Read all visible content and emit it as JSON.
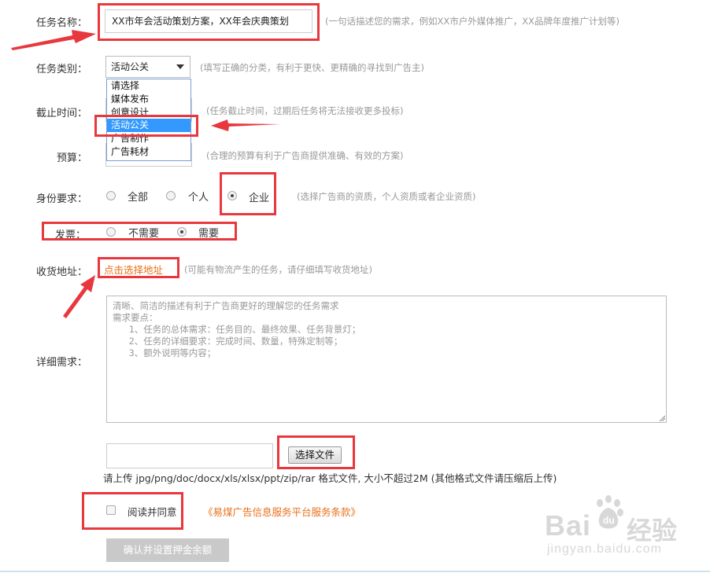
{
  "form": {
    "task_name": {
      "label": "任务名称：",
      "value": "XX市年会活动策划方案，XX年会庆典策划",
      "hint": "(一句话描述您的需求，例如XX市户外媒体推广，XX品牌年度推广计划等)"
    },
    "category": {
      "label": "任务类别：",
      "selected": "活动公关",
      "hint": "(填写正确的分类，有利于更快、更精确的寻找到广告主)",
      "options": [
        "请选择",
        "媒体发布",
        "创意设计",
        "活动公关",
        "广告制作",
        "广告耗材"
      ],
      "selected_index": 3
    },
    "deadline": {
      "label": "截止时间：",
      "hint": "(任务截止时间，过期后任务将无法接收更多投标)"
    },
    "budget": {
      "label": "预算：",
      "hint": "(合理的预算有利于广告商提供准确、有效的方案)"
    },
    "identity": {
      "label": "身份要求：",
      "options": [
        "全部",
        "个人",
        "企业"
      ],
      "selected_index": 2,
      "hint": "(选择广告商的资质，个人资质或者企业资质)"
    },
    "invoice": {
      "label": "发票：",
      "options": [
        "不需要",
        "需要"
      ],
      "selected_index": 1
    },
    "address": {
      "label": "收货地址：",
      "link": "点击选择地址",
      "hint": "(可能有物流产生的任务，请仔细填写收货地址)"
    },
    "detail": {
      "label": "详细需求：",
      "placeholder": "清晰、简洁的描述有利于广告商更好的理解您的任务需求\n需求要点：\n   1、任务的总体需求：任务目的、最终效果、任务背景灯；\n   2、任务的详细要求：完成时间、数量，特殊定制等；\n   3、额外说明等内容；"
    },
    "upload": {
      "button": "选择文件",
      "note": "请上传 jpg/png/doc/docx/xls/xlsx/ppt/zip/rar 格式文件, 大小不超过2M (其他格式文件请压缩后上传)"
    },
    "agreement": {
      "label": "阅读并同意",
      "link": "《易煤广告信息服务平台服务条款》"
    },
    "submit": "确认并设置押金余额"
  },
  "watermark": {
    "brand_left": "Bai",
    "brand_right": "经验",
    "url": "jingyan.baidu.com"
  },
  "colors": {
    "annotation_red": "#e8383d",
    "link_orange": "#e8701a",
    "selection_blue": "#3399ff",
    "hint_gray": "#999999",
    "button_gray": "#c9c9c9"
  }
}
